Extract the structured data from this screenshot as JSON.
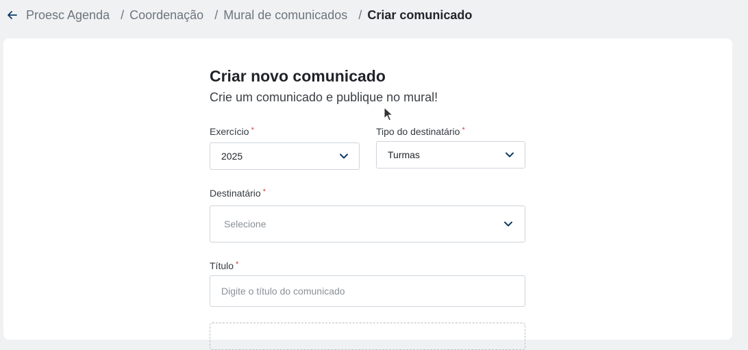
{
  "breadcrumb": {
    "items": [
      "Proesc Agenda",
      "Coordenação",
      "Mural de comunicados"
    ],
    "separator": "/",
    "current": "Criar comunicado"
  },
  "form": {
    "title": "Criar novo comunicado",
    "subtitle": "Crie um comunicado e publique no mural!",
    "required_mark": "*",
    "exercicio": {
      "label": "Exercício",
      "value": "2025"
    },
    "tipo_destinatario": {
      "label": "Tipo do destinatário",
      "value": "Turmas"
    },
    "destinatario": {
      "label": "Destinatário",
      "placeholder": "Selecione"
    },
    "titulo": {
      "label": "Título",
      "placeholder": "Digite o título do comunicado"
    }
  },
  "colors": {
    "accent": "#0d3b66",
    "required": "#d9363e",
    "background": "#f0f1f3"
  },
  "icons": {
    "back": "arrow-left-icon",
    "dropdown": "chevron-down-icon",
    "cursor": "mouse-pointer-icon"
  }
}
